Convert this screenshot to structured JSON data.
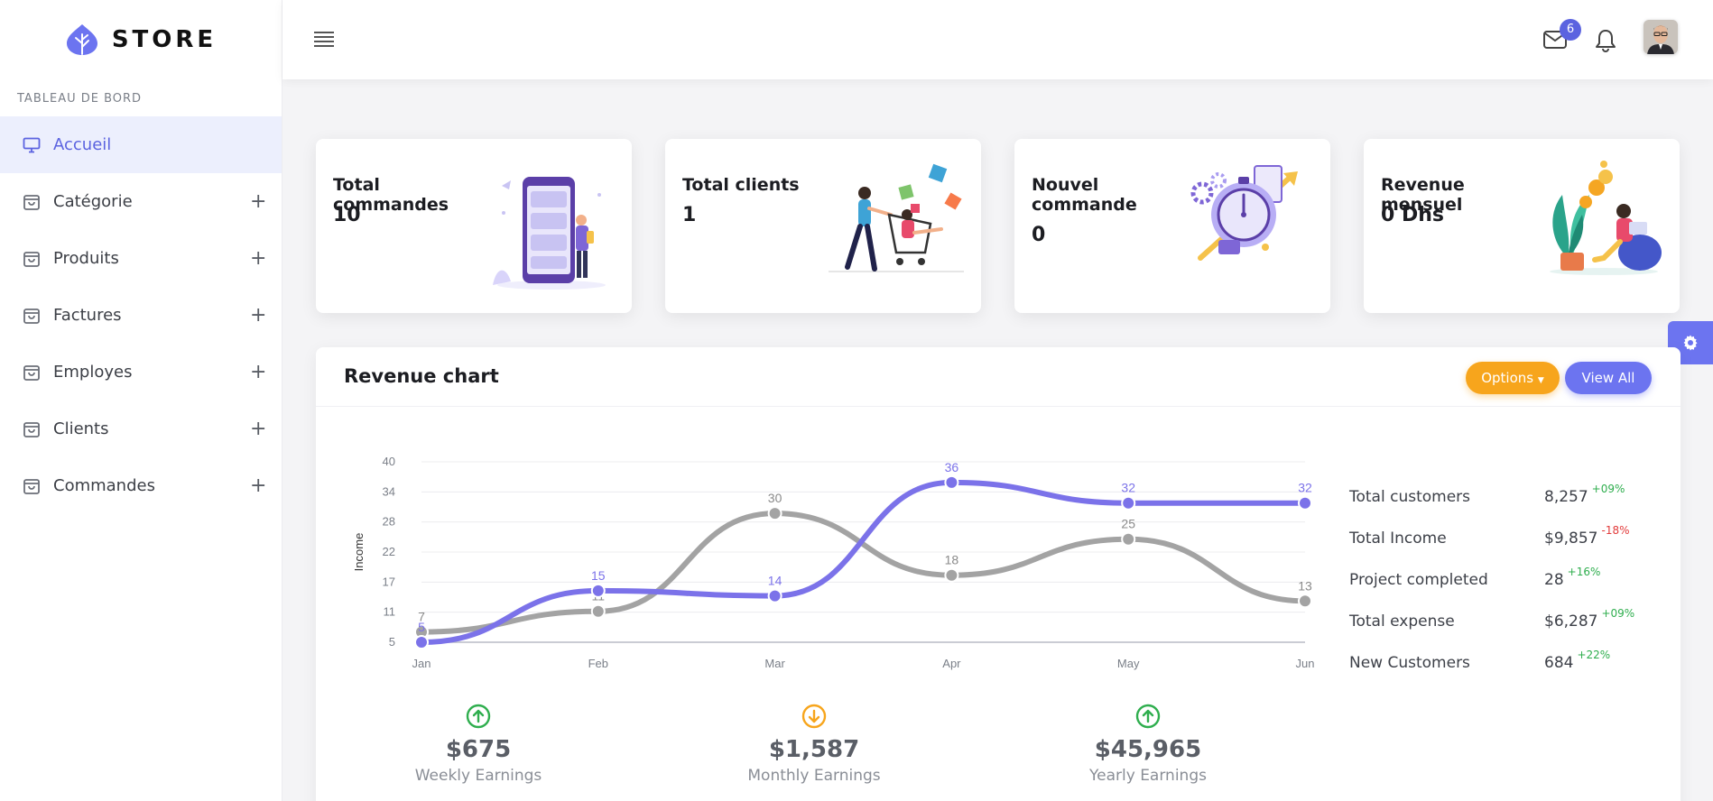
{
  "brand": {
    "name": "STORE"
  },
  "sidebar": {
    "section_title": "TABLEAU DE BORD",
    "items": [
      {
        "label": "Accueil",
        "icon": "monitor-icon",
        "active": true,
        "expandable": false
      },
      {
        "label": "Catégorie",
        "icon": "bag-icon",
        "expandable": true
      },
      {
        "label": "Produits",
        "icon": "bag-icon",
        "expandable": true
      },
      {
        "label": "Factures",
        "icon": "bag-icon",
        "expandable": true
      },
      {
        "label": "Employes",
        "icon": "bag-icon",
        "expandable": true
      },
      {
        "label": "Clients",
        "icon": "bag-icon",
        "expandable": true
      },
      {
        "label": "Commandes",
        "icon": "bag-icon",
        "expandable": true
      }
    ],
    "expand_symbol": "+"
  },
  "topbar": {
    "mail_badge": "6"
  },
  "cards": [
    {
      "title": "Total commandes",
      "value": "10"
    },
    {
      "title": "Total clients",
      "value": "1"
    },
    {
      "title": "Nouvel commande",
      "value": "0"
    },
    {
      "title": "Revenue mensuel",
      "value": "0 Dhs"
    }
  ],
  "panel": {
    "title": "Revenue chart",
    "options_label": "Options",
    "view_all_label": "View All"
  },
  "chart_data": {
    "type": "line",
    "categories": [
      "Jan",
      "Feb",
      "Mar",
      "Apr",
      "May",
      "Jun"
    ],
    "ylabel": "Income",
    "yticks": [
      5,
      11,
      17,
      22,
      28,
      34,
      40
    ],
    "ylim": [
      5,
      40
    ],
    "smooth": true,
    "grid": true,
    "series": [
      {
        "values": [
          5,
          15,
          14,
          36,
          32,
          32
        ],
        "color": "#7b72e9"
      },
      {
        "values": [
          7,
          11,
          30,
          18,
          25,
          13
        ],
        "color": "#a3a3a3"
      }
    ]
  },
  "stats": [
    {
      "label": "Total customers",
      "value": "8,257",
      "change": "+09%",
      "trend": "up"
    },
    {
      "label": "Total Income",
      "value": "$9,857",
      "change": "-18%",
      "trend": "down"
    },
    {
      "label": "Project completed",
      "value": "28",
      "change": "+16%",
      "trend": "up"
    },
    {
      "label": "Total expense",
      "value": "$6,287",
      "change": "+09%",
      "trend": "up"
    },
    {
      "label": "New Customers",
      "value": "684",
      "change": "+22%",
      "trend": "up"
    }
  ],
  "earnings": [
    {
      "value": "$675",
      "label": "Weekly Earnings",
      "trend": "up",
      "color": "#2fae4e"
    },
    {
      "value": "$1,587",
      "label": "Monthly Earnings",
      "trend": "down",
      "color": "#f7a51c"
    },
    {
      "value": "$45,965",
      "label": "Yearly Earnings",
      "trend": "up",
      "color": "#2fae4e"
    }
  ]
}
